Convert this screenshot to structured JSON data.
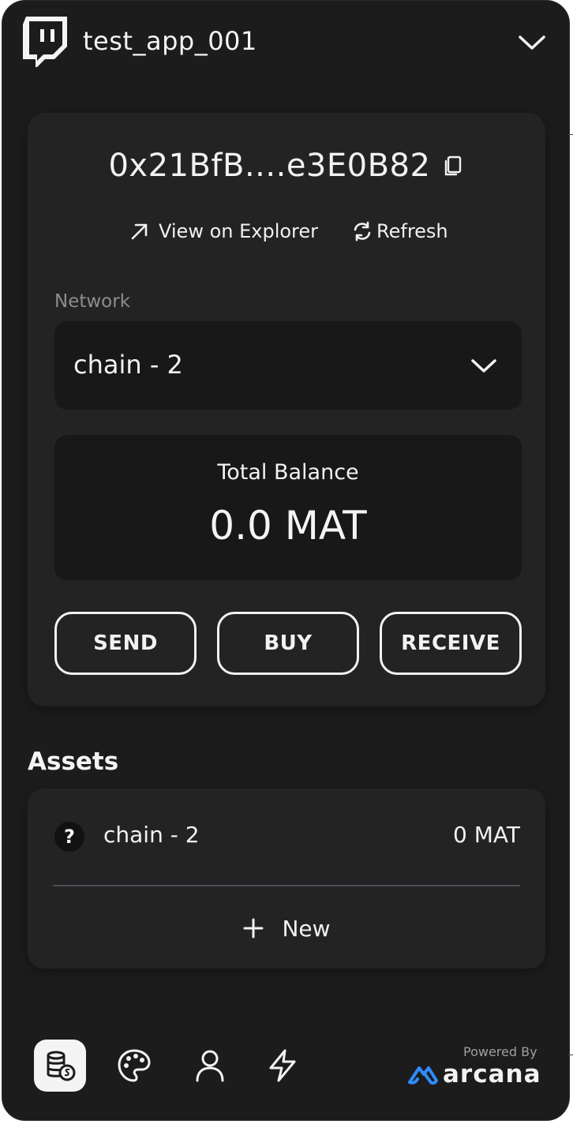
{
  "header": {
    "app_name": "test_app_001",
    "logo_icon": "twitch-icon"
  },
  "wallet": {
    "address": "0x21BfB....e3E0B82",
    "view_explorer_label": "View on Explorer",
    "refresh_label": "Refresh",
    "network_label": "Network",
    "network_selected": "chain - 2",
    "total_balance_label": "Total Balance",
    "total_balance_value": "0.0 MAT",
    "actions": {
      "send": "SEND",
      "buy": "BUY",
      "receive": "RECEIVE"
    }
  },
  "assets": {
    "title": "Assets",
    "items": [
      {
        "name": "chain - 2",
        "balance": "0 MAT",
        "icon": "question-icon",
        "icon_glyph": "?"
      }
    ],
    "new_label": "New"
  },
  "footer": {
    "nav_items": [
      {
        "name": "assets-nav",
        "icon": "coins-icon",
        "active": true
      },
      {
        "name": "theme-nav",
        "icon": "palette-icon",
        "active": false
      },
      {
        "name": "profile-nav",
        "icon": "user-icon",
        "active": false
      },
      {
        "name": "activity-nav",
        "icon": "lightning-icon",
        "active": false
      }
    ],
    "powered_by": "Powered By",
    "brand": "arcana"
  },
  "colors": {
    "background": "#1c1c1c",
    "card": "#232323",
    "field": "#181818",
    "text": "#f2f2f2",
    "muted": "#8d8d8d",
    "brand_blue": "#2f8cff"
  }
}
